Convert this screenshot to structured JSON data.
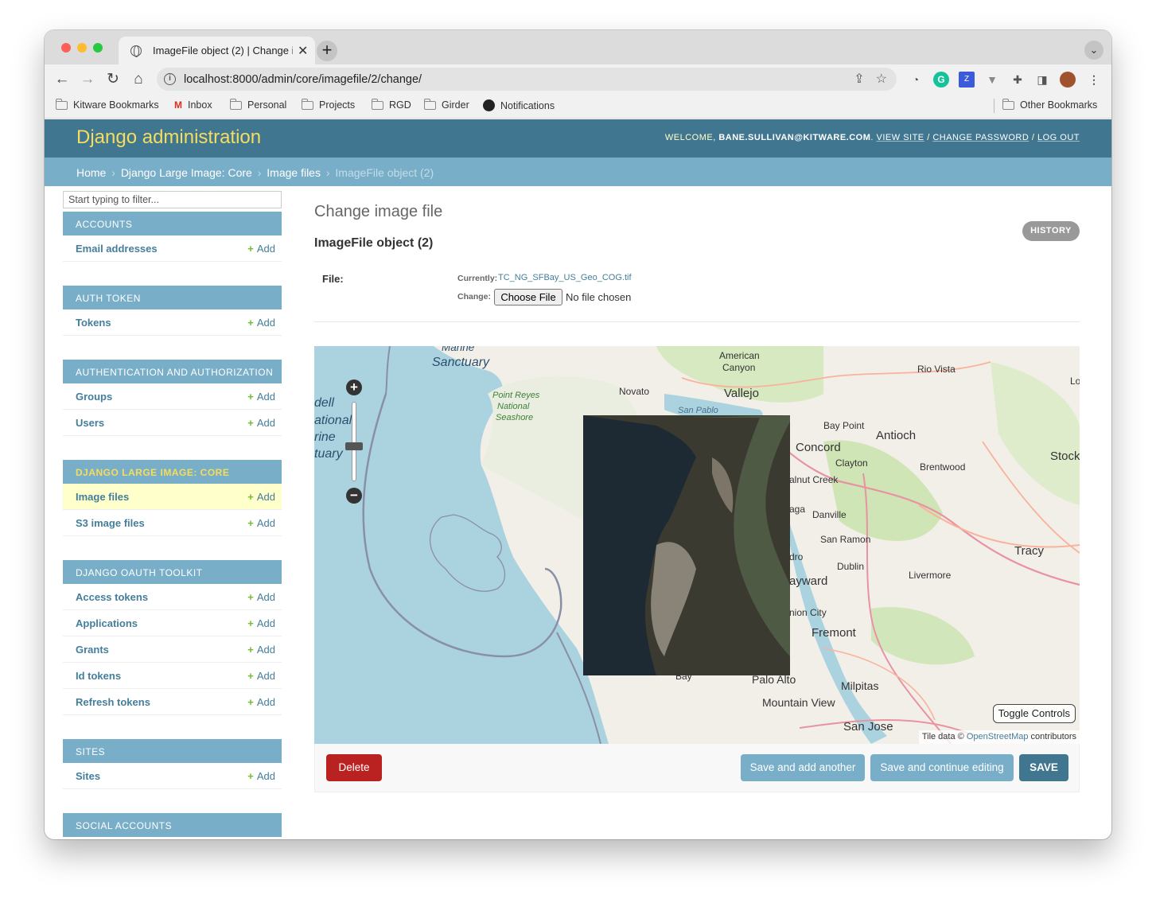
{
  "browser": {
    "tab_title": "ImageFile object (2) | Change i",
    "tab_close": "✕",
    "new_tab": "+",
    "tab_menu": "⌄",
    "url": "localhost:8000/admin/core/imagefile/2/change/",
    "info_icon": "i",
    "bookmarks": [
      "Kitware Bookmarks",
      "Inbox",
      "Personal",
      "Projects",
      "RGD",
      "Girder",
      "Notifications"
    ],
    "other_bookmarks": "Other Bookmarks"
  },
  "admin": {
    "brand": "Django administration",
    "welcome": "WELCOME, ",
    "user": "BANE.SULLIVAN@KITWARE.COM",
    "period": ". ",
    "view_site": "VIEW SITE",
    "slash": " / ",
    "change_password": "CHANGE PASSWORD",
    "log_out": "LOG OUT"
  },
  "breadcrumbs": {
    "home": "Home",
    "app": "Django Large Image: Core",
    "model": "Image files",
    "current": "ImageFile object (2)",
    "sep": "›"
  },
  "sidebar": {
    "filter_placeholder": "Start typing to filter...",
    "add_label": "Add",
    "collapse": "«",
    "modules": [
      {
        "caption": "ACCOUNTS",
        "items": [
          "Email addresses"
        ]
      },
      {
        "caption": "AUTH TOKEN",
        "items": [
          "Tokens"
        ]
      },
      {
        "caption": "AUTHENTICATION AND AUTHORIZATION",
        "items": [
          "Groups",
          "Users"
        ]
      },
      {
        "caption": "DJANGO LARGE IMAGE: CORE",
        "items": [
          "Image files",
          "S3 image files"
        ]
      },
      {
        "caption": "DJANGO OAUTH TOOLKIT",
        "items": [
          "Access tokens",
          "Applications",
          "Grants",
          "Id tokens",
          "Refresh tokens"
        ]
      },
      {
        "caption": "SITES",
        "items": [
          "Sites"
        ]
      },
      {
        "caption": "SOCIAL ACCOUNTS",
        "items": []
      }
    ]
  },
  "content": {
    "title": "Change image file",
    "history": "HISTORY",
    "object_title": "ImageFile object (2)",
    "file_label": "File:",
    "currently_label": "Currently:",
    "current_file": "TC_NG_SFBay_US_Geo_COG.tif",
    "change_label": "Change:",
    "choose_file": "Choose File",
    "no_file": "No file chosen"
  },
  "map": {
    "labels": {
      "marine": "Marine",
      "sanctuary": "Sanctuary",
      "dell": "dell",
      "national": "ational",
      "rine": "rine",
      "tuary": "tuary",
      "point_reyes": "Point Reyes",
      "pr_national": "National",
      "seashore": "Seashore",
      "american": "American",
      "canyon": "Canyon",
      "novato": "Novato",
      "vallejo": "Vallejo",
      "rio_vista": "Rio Vista",
      "lo": "Lo",
      "san_pablo": "San Pablo",
      "bay_point": "Bay Point",
      "antioch": "Antioch",
      "concord": "Concord",
      "clayton": "Clayton",
      "brentwood": "Brentwood",
      "stock": "Stock",
      "walnut_creek": "alnut Creek",
      "aga": "aga",
      "danville": "Danville",
      "san_ramon": "San Ramon",
      "tracy": "Tracy",
      "ldro": "dro",
      "dublin": "Dublin",
      "livermore": "Livermore",
      "hayward": "ayward",
      "union_city": "nion City",
      "fremont": "Fremont",
      "bay": "Bay",
      "palo_alto": "Palo Alto",
      "milpitas": "Milpitas",
      "mountain_view": "Mountain View",
      "san_jose": "San Jose"
    },
    "zoom_in": "+",
    "zoom_out": "−",
    "toggle_controls": "Toggle Controls",
    "attribution_prefix": "Tile data © ",
    "attribution_link": "OpenStreetMap",
    "attribution_suffix": " contributors",
    "colors": {
      "water": "#aad3df",
      "land": "#f2efe9",
      "imagery": "#3b3a30"
    }
  },
  "actions": {
    "delete": "Delete",
    "save_add_another": "Save and add another",
    "save_continue": "Save and continue editing",
    "save": "SAVE"
  },
  "colors": {
    "header": "#417690",
    "breadcrumbs": "#79aec8",
    "brand": "#f5dd5d",
    "link": "#447e9b",
    "add": "#70bf2b",
    "delete": "#ba2121"
  }
}
